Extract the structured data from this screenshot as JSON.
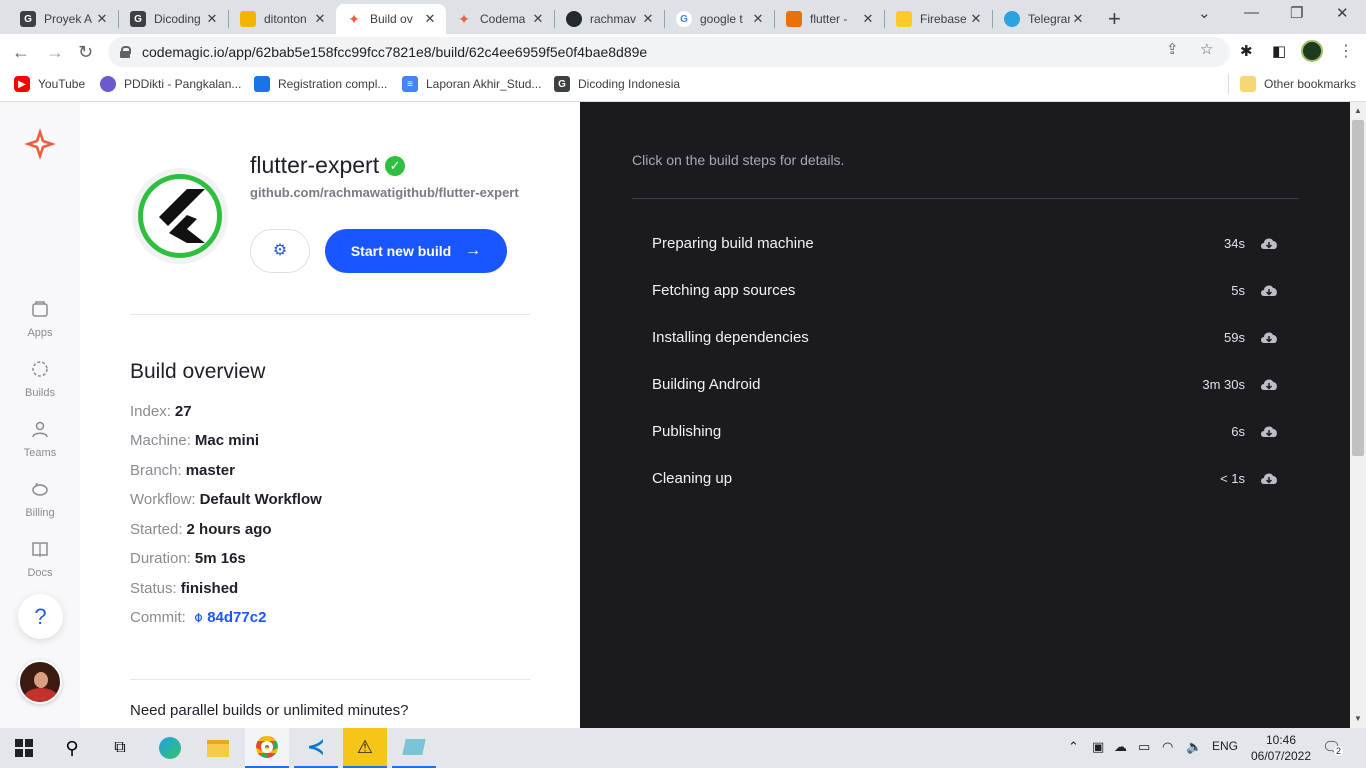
{
  "browser": {
    "tabs": [
      {
        "title": "Proyek A",
        "color": "#3c4043",
        "glyph": "G"
      },
      {
        "title": "Dicoding",
        "color": "#3c4043",
        "glyph": "G"
      },
      {
        "title": "ditonton",
        "color": "#f4b400",
        "glyph": ""
      },
      {
        "title": "Build ov",
        "color": "#f25a3c",
        "glyph": ""
      },
      {
        "title": "Codema",
        "color": "#f25a3c",
        "glyph": ""
      },
      {
        "title": "rachmav",
        "color": "#24292e",
        "glyph": ""
      },
      {
        "title": "google t",
        "color": "#4285f4",
        "glyph": "G"
      },
      {
        "title": "flutter -",
        "color": "#e8710a",
        "glyph": ""
      },
      {
        "title": "Firebase",
        "color": "#ffca28",
        "glyph": ""
      },
      {
        "title": "Telegran",
        "color": "#2aa3e0",
        "glyph": ""
      }
    ],
    "url": "codemagic.io/app/62bab5e158fcc99fcc7821e8/build/62c4ee6959f5e0f4bae8d89e",
    "bookmarks": [
      {
        "label": "YouTube",
        "color": "#ff0000"
      },
      {
        "label": "PDDikti - Pangkalan...",
        "color": "#6a5acd"
      },
      {
        "label": "Registration compl...",
        "color": "#1a73e8"
      },
      {
        "label": "Laporan Akhir_Stud...",
        "color": "#4285f4"
      },
      {
        "label": "Dicoding Indonesia",
        "color": "#3c4043"
      }
    ],
    "other_bookmarks": "Other bookmarks"
  },
  "sidebar": {
    "items": [
      {
        "label": "Apps"
      },
      {
        "label": "Builds"
      },
      {
        "label": "Teams"
      },
      {
        "label": "Billing"
      },
      {
        "label": "Docs"
      }
    ],
    "help": "?"
  },
  "app": {
    "name": "flutter-expert",
    "repo": "github.com/rachmawatigithub/flutter-expert",
    "start_button": "Start new build",
    "accent": "#1a56ff",
    "success": "#2fbf3f"
  },
  "overview": {
    "title": "Build overview",
    "rows": [
      {
        "label": "Index:",
        "value": "27"
      },
      {
        "label": "Machine:",
        "value": "Mac mini"
      },
      {
        "label": "Branch:",
        "value": "master"
      },
      {
        "label": "Workflow:",
        "value": "Default Workflow"
      },
      {
        "label": "Started:",
        "value": "2 hours ago"
      },
      {
        "label": "Duration:",
        "value": "5m 16s"
      },
      {
        "label": "Status:",
        "value": "finished"
      },
      {
        "label": "Commit:",
        "value": "84d77c2"
      }
    ],
    "promo": "Need parallel builds or unlimited minutes?"
  },
  "steps_panel": {
    "hint": "Click on the build steps for details.",
    "steps": [
      {
        "name": "Preparing build machine",
        "duration": "34s"
      },
      {
        "name": "Fetching app sources",
        "duration": "5s"
      },
      {
        "name": "Installing dependencies",
        "duration": "59s"
      },
      {
        "name": "Building Android",
        "duration": "3m 30s"
      },
      {
        "name": "Publishing",
        "duration": "6s"
      },
      {
        "name": "Cleaning up",
        "duration": "< 1s"
      }
    ]
  },
  "taskbar": {
    "lang": "ENG",
    "time": "10:46",
    "date": "06/07/2022",
    "notifications": "2"
  }
}
